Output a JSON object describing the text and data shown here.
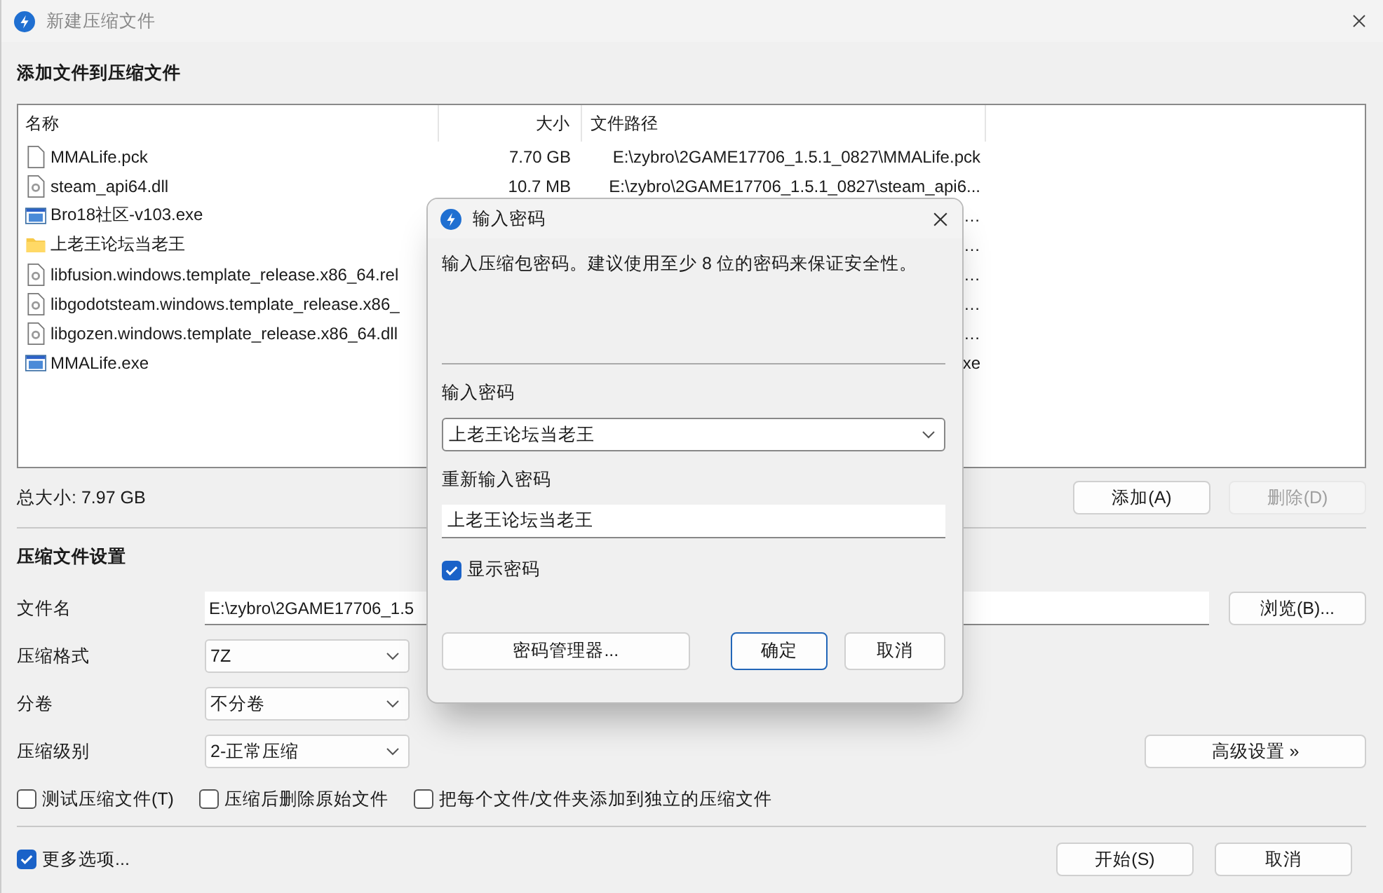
{
  "window": {
    "title": "新建压缩文件"
  },
  "files_section": {
    "heading": "添加文件到压缩文件",
    "columns": [
      "名称",
      "大小",
      "文件路径"
    ],
    "rows": [
      {
        "kind": "blank",
        "name": "MMALife.pck",
        "size": "7.70 GB",
        "path": "E:\\zybro\\2GAME17706_1.5.1_0827\\MMALife.pck"
      },
      {
        "kind": "dll",
        "name": "steam_api64.dll",
        "size": "10.7 MB",
        "path": "E:\\zybro\\2GAME17706_1.5.1_0827\\steam_api6..."
      },
      {
        "kind": "exe",
        "name": "Bro18社区-v103.exe",
        "path": "…"
      },
      {
        "kind": "folder",
        "name": "上老王论坛当老王",
        "path": "…"
      },
      {
        "kind": "dll",
        "name": "libfusion.windows.template_release.x86_64.rel",
        "path": "…"
      },
      {
        "kind": "dll",
        "name": "libgodotsteam.windows.template_release.x86_",
        "path": "…"
      },
      {
        "kind": "dll",
        "name": "libgozen.windows.template_release.x86_64.dll",
        "path": "…"
      },
      {
        "kind": "exe",
        "name": "MMALife.exe",
        "path": "xe"
      }
    ],
    "total": "总大小: 7.97 GB",
    "buttons": [
      {
        "label": "添加(A)",
        "disabled": false
      },
      {
        "label": "删除(D)",
        "disabled": true
      }
    ]
  },
  "settings": {
    "heading": "压缩文件设置",
    "filename": {
      "label": "文件名",
      "value": "E:\\zybro\\2GAME17706_1.5"
    },
    "browse_button": "浏览(B)...",
    "selects": [
      {
        "label": "压缩格式",
        "value": "7Z"
      },
      {
        "label": "分卷",
        "value": "不分卷"
      },
      {
        "label": "压缩级别",
        "value": "2-正常压缩"
      }
    ],
    "advanced_button": "高级设置 »",
    "options": [
      {
        "label": "测试压缩文件(T)",
        "checked": false
      },
      {
        "label": "压缩后删除原始文件",
        "checked": false
      },
      {
        "label": "把每个文件/文件夹添加到独立的压缩文件",
        "checked": false
      }
    ]
  },
  "footer": {
    "more_options": {
      "label": "更多选项...",
      "checked": true
    },
    "buttons": [
      "开始(S)",
      "取消"
    ]
  },
  "dialog": {
    "title": "输入密码",
    "message": "输入压缩包密码。建议使用至少 8 位的密码来保证安全性。",
    "password_label": "输入密码",
    "password": "上老王论坛当老王",
    "confirm_label": "重新输入密码",
    "confirm": "上老王论坛当老王",
    "show_password": {
      "label": "显示密码",
      "checked": true
    },
    "buttons": [
      {
        "label": "密码管理器...",
        "kind": "wide"
      },
      {
        "label": "确定",
        "kind": "default"
      },
      {
        "label": "取消",
        "kind": "normal"
      }
    ]
  }
}
